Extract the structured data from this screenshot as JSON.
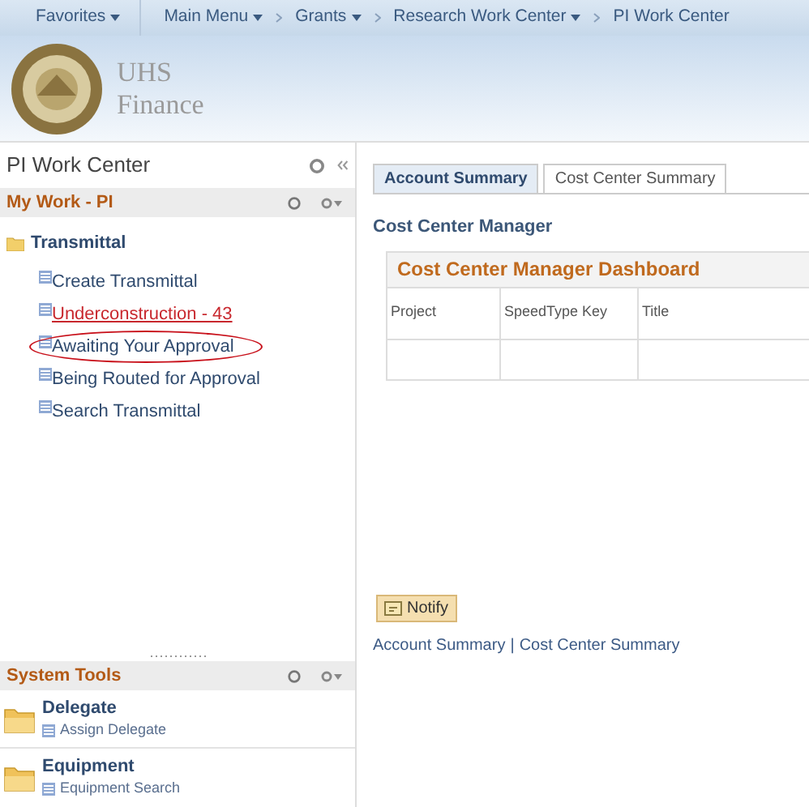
{
  "nav": [
    {
      "label": "Favorites",
      "dropdown": true
    },
    {
      "label": "Main Menu",
      "dropdown": true
    },
    {
      "label": "Grants",
      "dropdown": true
    },
    {
      "label": "Research Work Center",
      "dropdown": true
    },
    {
      "label": "PI Work Center",
      "dropdown": false
    }
  ],
  "brand": {
    "line_1": "UHS",
    "line_2": "Finance"
  },
  "sidebar": {
    "title": "PI Work Center",
    "my_work": {
      "title": "My Work - PI",
      "folder": {
        "label": "Transmittal",
        "children": [
          {
            "label": "Create Transmittal",
            "kind": "link",
            "circled": false
          },
          {
            "label": "Underconstruction - 43",
            "kind": "alert",
            "circled": false
          },
          {
            "label": "Awaiting Your Approval",
            "kind": "link",
            "circled": true
          },
          {
            "label": "Being Routed for Approval",
            "kind": "link",
            "circled": false
          },
          {
            "label": "Search Transmittal",
            "kind": "link",
            "circled": false
          }
        ]
      }
    },
    "system_tools": {
      "title": "System Tools",
      "groups": [
        {
          "label": "Delegate",
          "children": [
            {
              "label": "Assign Delegate"
            }
          ]
        },
        {
          "label": "Equipment",
          "children": [
            {
              "label": "Equipment Search"
            }
          ]
        }
      ]
    }
  },
  "tabs": [
    {
      "label": "Account Summary",
      "selected": true
    },
    {
      "label": "Cost Center Summary",
      "selected": false
    }
  ],
  "section_title": "Cost Center Manager",
  "dashboard": {
    "title": "Cost Center Manager Dashboard",
    "columns": [
      "Project",
      "SpeedType Key",
      "Title"
    ]
  },
  "notify_button": "Notify",
  "footer_links": [
    "Account Summary",
    "Cost Center Summary"
  ],
  "footer_separator": "|"
}
